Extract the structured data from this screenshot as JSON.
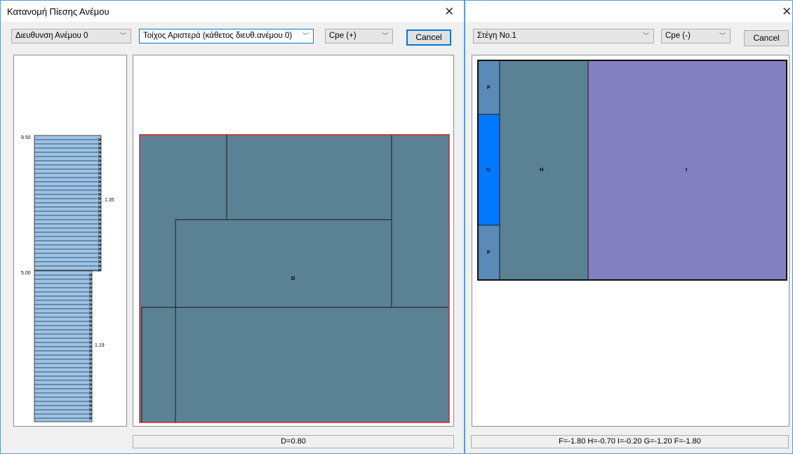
{
  "left_window": {
    "title": "Κατανομή Πίεσης Ανέμου",
    "close_glyph": "✕",
    "wind_direction_select": "Διευθυνση Ανέμου 0",
    "wall_select": "Τοίχος Αριστερά (κάθετος διευθ.ανέμου 0)",
    "cpe_select": "Cpe (+)",
    "cancel_label": "Cancel",
    "profile": {
      "top_height": "9.50",
      "mid_height": "5.00",
      "upper_pressure": "1.35",
      "lower_pressure": "1.19"
    },
    "wall_zone_label": "D",
    "status": "D=0.80"
  },
  "right_window": {
    "close_glyph": "✕",
    "roof_select": "Στέγη No.1",
    "cpe_select": "Cpe (-)",
    "cancel_label": "Cancel",
    "zones": [
      "F",
      "G",
      "F",
      "H",
      "I"
    ],
    "status": "F=-1.80 H=-0.70 I=-0.20 G=-1.20 F=-1.80"
  },
  "colors": {
    "window_border": "#5a9bd5",
    "wall_fill": "#5b8194",
    "wall_outline": "#e02020",
    "profile_fill": "#9dc3e6",
    "zone_f": "#5a8ab7",
    "zone_g": "#0078ff",
    "zone_h": "#5b8194",
    "zone_i": "#837fc1",
    "accent": "#0078d7"
  },
  "icons": {
    "close": "close-icon",
    "dropdown": "chevron-down-icon"
  }
}
